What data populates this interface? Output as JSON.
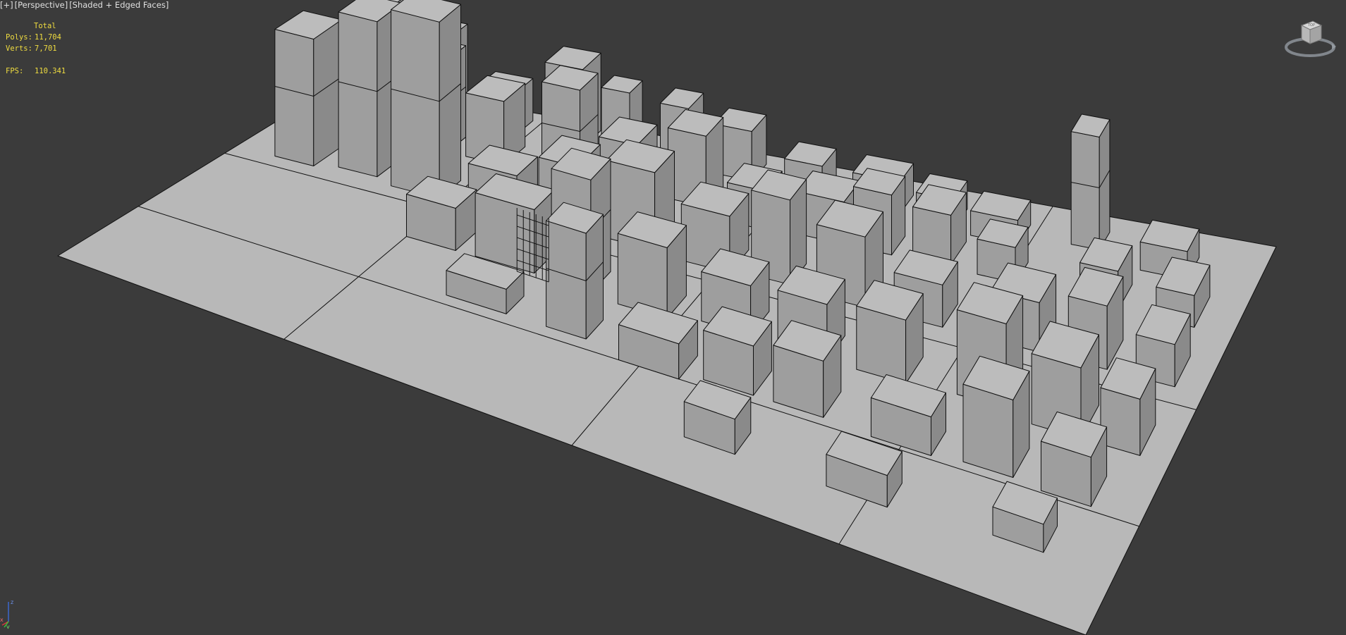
{
  "viewport": {
    "label_plus": "[+]",
    "label_view": "[Perspective]",
    "label_mode": "[Shaded + Edged Faces]"
  },
  "stats": {
    "header": "Total",
    "polys_label": "Polys:",
    "polys_value": "11,704",
    "verts_label": "Verts:",
    "verts_value": "7,701",
    "fps_label": "FPS:",
    "fps_value": "110.341"
  },
  "viewcube": {
    "face": "TOP"
  },
  "axis": {
    "x": "x",
    "y": "y",
    "z": "z"
  },
  "colors": {
    "background": "#3b3b3b",
    "ground": "#b8b8b8",
    "building_top": "#bcbcbc",
    "building_left": "#9e9e9e",
    "building_right": "#8a8a8a",
    "edge": "#101010",
    "stats_text": "#f0dd40"
  }
}
